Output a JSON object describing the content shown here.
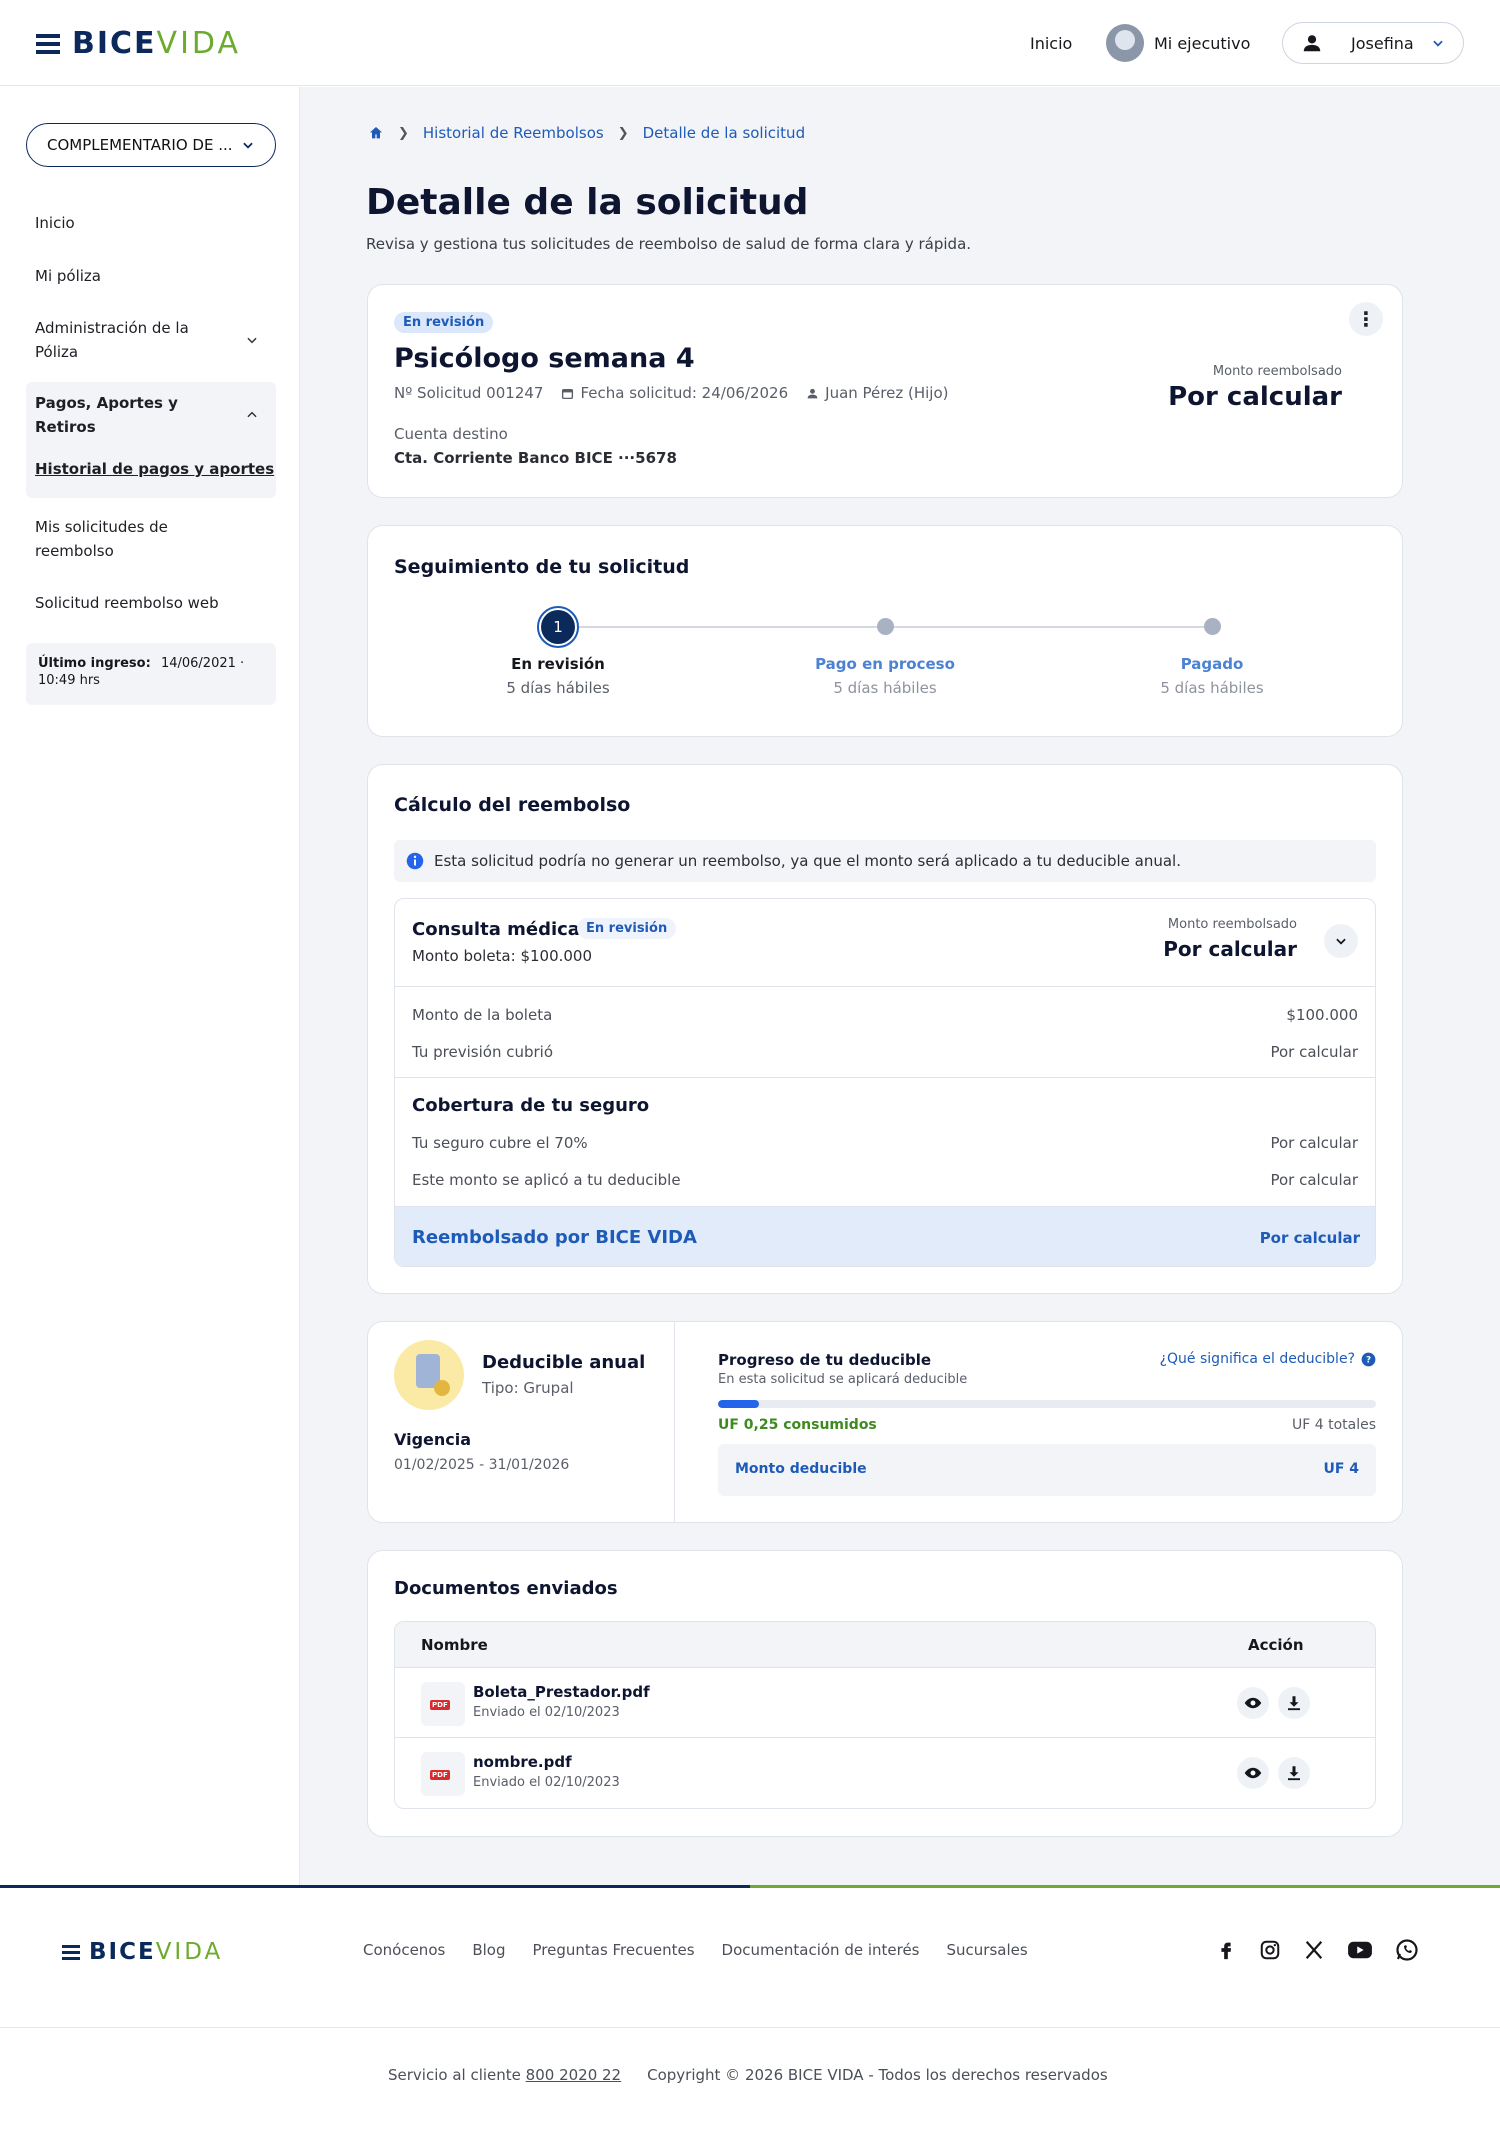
{
  "header": {
    "logo": {
      "part1": "BICE",
      "part2": "VIDA"
    },
    "nav_home": "Inicio",
    "executive": "Mi ejecutivo",
    "user": "Josefina"
  },
  "sidebar": {
    "policy_dropdown": "COMPLEMENTARIO DE ...",
    "items": [
      {
        "label": "Inicio"
      },
      {
        "label": "Mi póliza"
      },
      {
        "label": "Administración de la Póliza"
      },
      {
        "label": "Pagos, Aportes y Retiros"
      },
      {
        "label": "Historial de pagos y aportes"
      },
      {
        "label": "Mis solicitudes de reembolso"
      },
      {
        "label": "Solicitud reembolso web"
      }
    ],
    "last_login_label": "Último ingreso:",
    "last_login_value": "14/06/2021 · 10:49 hrs"
  },
  "breadcrumb": {
    "item1": "Historial de Reembolsos",
    "item2": "Detalle de la solicitud"
  },
  "page": {
    "title": "Detalle de la solicitud",
    "subtitle": "Revisa y gestiona tus solicitudes de reembolso de salud de forma clara y rápida."
  },
  "request": {
    "status": "En revisión",
    "name": "Psicólogo semana 4",
    "number": "Nº Solicitud 001247",
    "date": "Fecha solicitud: 24/06/2026",
    "person": "Juan Pérez (Hijo)",
    "account_label": "Cuenta destino",
    "account_value": "Cta. Corriente Banco BICE ···5678",
    "amount_label": "Monto reembolsado",
    "amount_value": "Por calcular"
  },
  "tracking": {
    "title": "Seguimiento de tu solicitud",
    "steps": [
      {
        "number": "1",
        "label": "En revisión",
        "sub": "5 días hábiles"
      },
      {
        "label": "Pago en proceso",
        "sub": "5 días hábiles"
      },
      {
        "label": "Pagado",
        "sub": "5 días hábiles"
      }
    ]
  },
  "calc": {
    "title": "Cálculo del reembolso",
    "info": "Esta solicitud podría no generar un reembolso, ya que el monto será aplicado a tu deducible anual.",
    "item_name": "Consulta médica",
    "item_status": "En revisión",
    "item_boleta": "Monto boleta: $100.000",
    "item_amount_label": "Monto reembolsado",
    "item_amount_value": "Por calcular",
    "rows": [
      {
        "label": "Monto de la boleta",
        "value": "$100.000"
      },
      {
        "label": "Tu previsión cubrió",
        "value": "Por calcular"
      }
    ],
    "coverage_title": "Cobertura de tu seguro",
    "coverage_rows": [
      {
        "label": "Tu seguro cubre el 70%",
        "value": "Por calcular"
      },
      {
        "label": "Este monto se aplicó a tu deducible",
        "value": "Por calcular"
      }
    ],
    "total_label": "Reembolsado por BICE VIDA",
    "total_value": "Por calcular"
  },
  "deductible": {
    "title": "Deducible anual",
    "type": "Tipo: Grupal",
    "validity_label": "Vigencia",
    "validity_value": "01/02/2025  - 31/01/2026",
    "progress_title": "Progreso de tu deducible",
    "progress_sub": "En esta solicitud se aplicará deducible",
    "help_link": "¿Qué significa el deducible?",
    "consumed": "UF 0,25 consumidos",
    "total": "UF 4 totales",
    "progress_fraction": 0.0625,
    "amount_label": "Monto deducible",
    "amount_value": "UF 4"
  },
  "documents": {
    "title": "Documentos enviados",
    "col_name": "Nombre",
    "col_action": "Acción",
    "files": [
      {
        "name": "Boleta_Prestador.pdf",
        "sent": "Enviado el 02/10/2023",
        "type": "PDF"
      },
      {
        "name": "nombre.pdf",
        "sent": "Enviado el 02/10/2023",
        "type": "PDF"
      }
    ]
  },
  "footer": {
    "links": [
      "Conócenos",
      "Blog",
      "Preguntas Frecuentes",
      "Documentación de interés",
      "Sucursales"
    ],
    "service_label": "Servicio al cliente",
    "phone": "800 2020 22",
    "copyright": "Copyright © 2026 BICE VIDA - Todos los derechos reservados"
  },
  "colors": {
    "brand_navy": "#0b2a5b",
    "brand_green": "#6cab2e",
    "link_blue": "#1e5bb8",
    "accent_blue": "#2563eb"
  }
}
